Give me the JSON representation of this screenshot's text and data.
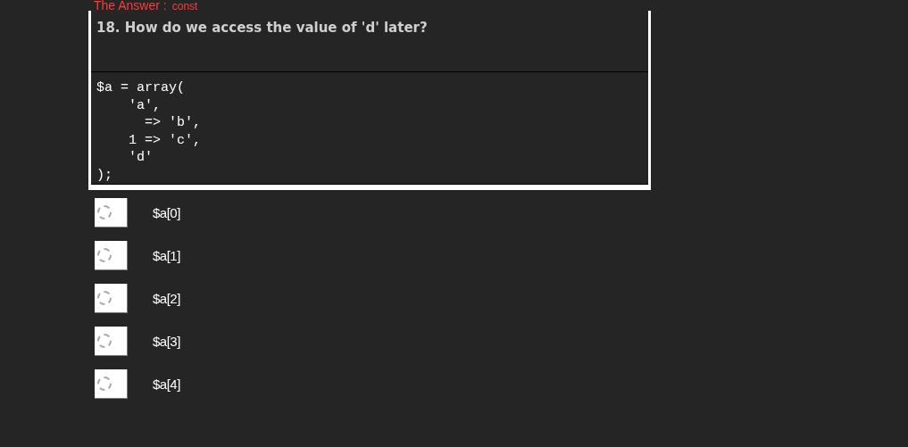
{
  "answer": {
    "label": "The Answer :",
    "value": "const"
  },
  "question": {
    "title": "18. How do we access the value of 'd' later?",
    "code": "$a = array(\n    'a',\n      => 'b',\n    1 => 'c',\n    'd'\n);"
  },
  "options": [
    {
      "label": "$a[0]",
      "selected": false
    },
    {
      "label": "$a[1]",
      "selected": false
    },
    {
      "label": "$a[2]",
      "selected": false
    },
    {
      "label": "$a[3]",
      "selected": false
    },
    {
      "label": "$a[4]",
      "selected": false
    }
  ]
}
